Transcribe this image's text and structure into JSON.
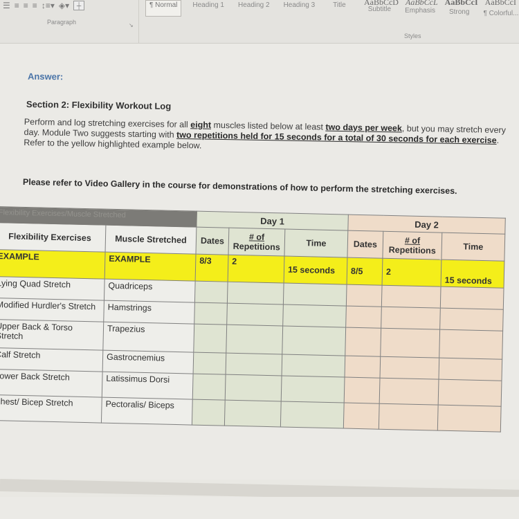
{
  "ribbon": {
    "paragraph_group_label": "Paragraph",
    "styles_group_label": "Styles",
    "paragraph_icons": [
      "align-left-icon",
      "align-center-icon",
      "align-right-icon",
      "justify-icon",
      "line-spacing-icon",
      "shading-icon",
      "borders-icon"
    ],
    "styles": [
      {
        "label": "¶ Normal",
        "selected": true
      },
      {
        "label": "Heading 1"
      },
      {
        "label": "Heading 2"
      },
      {
        "label": "Heading 3"
      },
      {
        "label": "Title"
      },
      {
        "label": "Subtitle"
      },
      {
        "label": "Emphasis"
      },
      {
        "label": "Strong"
      },
      {
        "label": "¶ Colorful..."
      }
    ],
    "style_previews": [
      "AaBbCcD",
      "AaBbCcL",
      "AaBbCcI",
      "AaBbCcI"
    ]
  },
  "document": {
    "answer_label": "Answer:",
    "section_title": "Section 2: Flexibility Workout Log",
    "paragraph": {
      "p1": "Perform and log stretching exercises for all ",
      "u1": "eight",
      "p2": " muscles listed below at least ",
      "u2": "two days per week",
      "p3": ", but you may stretch every day. Module Two suggests starting with ",
      "u3": "two repetitions held for 15 seconds for a total of 30 seconds for each exercise",
      "p4": ". Refer to the yellow highlighted example below."
    },
    "refer_note": "Please refer to Video Gallery in the course for demonstrations of how to perform the stretching exercises."
  },
  "table": {
    "merged_header": "Flexibility Exercises/Muscle Stretched",
    "day1_label": "Day 1",
    "day2_label": "Day 2",
    "columns": {
      "exercise": "Flexibility Exercises",
      "muscle": "Muscle Stretched",
      "dates": "Dates",
      "reps_prefix": "# of",
      "reps": "Repetitions",
      "time": "Time"
    },
    "example": {
      "exercise": "EXAMPLE",
      "muscle": "EXAMPLE",
      "day1": {
        "date": "8/3",
        "reps": "2",
        "time": "15 seconds"
      },
      "day2": {
        "date": "8/5",
        "reps": "2",
        "time": "15 seconds"
      }
    },
    "rows": [
      {
        "exercise": "Lying Quad Stretch",
        "muscle": "Quadriceps"
      },
      {
        "exercise": "Modified Hurdler's Stretch",
        "muscle": "Hamstrings"
      },
      {
        "exercise": "Upper Back & Torso Stretch",
        "muscle": "Trapezius"
      },
      {
        "exercise": "Calf Stretch",
        "muscle": "Gastrocnemius"
      },
      {
        "exercise": "Lower Back Stretch",
        "muscle": "Latissimus Dorsi"
      },
      {
        "exercise": "Chest/ Bicep Stretch",
        "muscle": "Pectoralis/ Biceps"
      }
    ]
  },
  "colors": {
    "answer_blue": "#4a74a8",
    "highlight_yellow": "#f4ee1a",
    "day1_green": "#dfe4d2",
    "day2_peach": "#efdcc9",
    "merged_header_gray": "#7c7b77"
  }
}
